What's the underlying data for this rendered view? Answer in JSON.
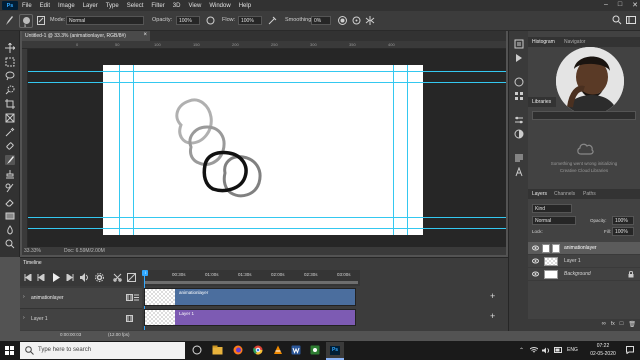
{
  "menubar": {
    "logo": "Ps",
    "items": [
      "File",
      "Edit",
      "Image",
      "Layer",
      "Type",
      "Select",
      "Filter",
      "3D",
      "View",
      "Window",
      "Help"
    ]
  },
  "options": {
    "brush_size": "5",
    "mode_label": "Mode:",
    "mode_value": "Normal",
    "opacity_label": "Opacity:",
    "opacity_value": "100%",
    "flow_label": "Flow:",
    "flow_value": "100%",
    "smoothing_label": "Smoothing:",
    "smoothing_value": "0%"
  },
  "document": {
    "tab_title": "Untitled-1 @ 33.3% (animationlayer, RGB/8#)"
  },
  "rulers": {
    "top_ticks": [
      "0",
      "50",
      "100",
      "150",
      "200",
      "250",
      "300",
      "350",
      "400"
    ]
  },
  "status": {
    "zoom": "33.33%",
    "doc_info": "Doc: 6.59M/2.00M"
  },
  "panels": {
    "histogram_tabs": [
      "Histogram",
      "Navigator"
    ],
    "libraries_tab": "Libraries",
    "library_error_line1": "Something went wrong initializing",
    "library_error_line2": "Creative Cloud Libraries",
    "layer_tabs": [
      "Layers",
      "Channels",
      "Paths"
    ],
    "kind_label": "Kind",
    "blend_mode": "Normal",
    "opacity_label": "Opacity:",
    "opacity_value": "100%",
    "lock_label": "Lock:",
    "fill_label": "Fill:",
    "fill_value": "100%",
    "layers": [
      {
        "name": "animationlayer",
        "selected": true,
        "italic": false
      },
      {
        "name": "Layer 1",
        "selected": false,
        "italic": false
      },
      {
        "name": "Background",
        "selected": false,
        "italic": true
      }
    ]
  },
  "timeline": {
    "title": "Timeline",
    "ruler_ticks": [
      "00:30s",
      "01:00s",
      "01:30s",
      "02:00s",
      "02:30s",
      "03:00s"
    ],
    "playhead_frame": "0",
    "tooltip": "Play",
    "tracks": [
      {
        "name": "animationlayer",
        "clip_label": "animationlayer",
        "color": "#4b6e9e"
      },
      {
        "name": "Layer 1",
        "clip_label": "Layer 1",
        "color": "#7d5bb3"
      }
    ],
    "timecode": "0:00:00:03",
    "fps": "(12.00 fps)"
  },
  "taskbar": {
    "search_placeholder": "Type here to search",
    "language": "ENG",
    "time": "07:22",
    "date": "02-05-2020"
  },
  "colors": {
    "guide": "#34c8f0",
    "accent": "#31a8ff",
    "stroke_black": "#111111",
    "stroke_gray": "#8a8a8a"
  }
}
